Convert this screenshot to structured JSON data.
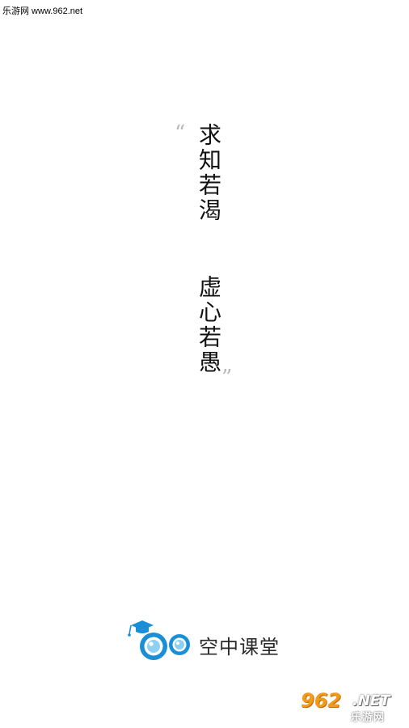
{
  "watermark_top": "乐游网 www.962.net",
  "quote": {
    "open_mark": "“",
    "close_mark": "”",
    "line1": "求知若渴",
    "line2": "虚心若愚"
  },
  "logo": {
    "text": "空中课堂",
    "icon": "owl-graduation-cap-icon"
  },
  "watermark_bottom": {
    "number": "962",
    "net": ".NET",
    "chinese": "乐游网"
  },
  "colors": {
    "logo_blue": "#1a8fd6",
    "logo_light_blue": "#8fd0f2",
    "watermark_orange": "#f29a1a"
  }
}
